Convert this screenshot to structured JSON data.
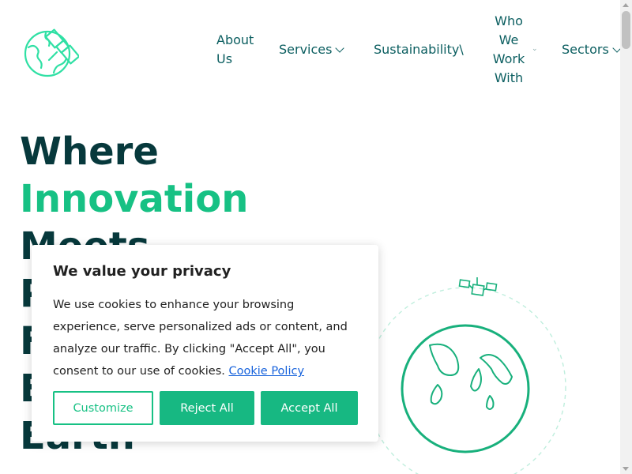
{
  "nav": {
    "about": "About Us",
    "services": "Services",
    "sustainability": "Sustainability\\",
    "who": "Who We Work With",
    "sectors": "Sectors"
  },
  "hero": {
    "line1": "Where",
    "line2": "Innovation",
    "line3": "Meets",
    "line4": "P",
    "line5": "F",
    "line6": "E",
    "line7": "Earth"
  },
  "cookie": {
    "title": "We value your privacy",
    "text": "We use cookies to enhance your browsing experience, serve personalized ads or content, and analyze our traffic. By clicking \"Accept All\", you consent to our use of cookies.",
    "link": "Cookie Policy",
    "customize": "Customize",
    "reject": "Reject All",
    "accept": "Accept All"
  },
  "colors": {
    "brand": "#17c184",
    "dark": "#07393c",
    "nav": "#0b5e60",
    "link": "#1863dc"
  },
  "icons": {
    "logo": "satellite-globe-icon",
    "illustration": "earth-satellite-illustration"
  }
}
